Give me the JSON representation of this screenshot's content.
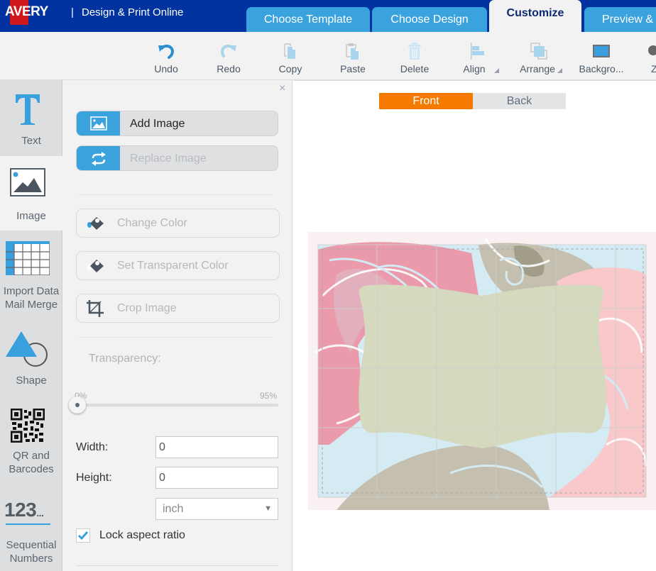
{
  "header": {
    "logo": "AVERY",
    "separator": "|",
    "title": "Design & Print Online",
    "tabs": [
      {
        "label": "Choose Template",
        "active": false
      },
      {
        "label": "Choose Design",
        "active": false
      },
      {
        "label": "Customize",
        "active": true
      },
      {
        "label": "Preview &",
        "active": false
      }
    ]
  },
  "toolbar": {
    "items": [
      {
        "label": "Undo",
        "icon": "undo-icon",
        "enabled": true
      },
      {
        "label": "Redo",
        "icon": "redo-icon",
        "enabled": false
      },
      {
        "label": "Copy",
        "icon": "copy-icon",
        "enabled": false
      },
      {
        "label": "Paste",
        "icon": "paste-icon",
        "enabled": false
      },
      {
        "label": "Delete",
        "icon": "delete-icon",
        "enabled": false
      },
      {
        "label": "Align",
        "icon": "align-icon",
        "enabled": false
      },
      {
        "label": "Arrange",
        "icon": "arrange-icon",
        "enabled": false
      },
      {
        "label": "Backgro...",
        "icon": "background-icon",
        "enabled": true
      },
      {
        "label": "Z",
        "icon": "zoom-icon",
        "enabled": true
      }
    ]
  },
  "sidebar": {
    "items": [
      {
        "label": "Text",
        "icon": "text-icon",
        "active": false
      },
      {
        "label": "Image",
        "icon": "image-icon",
        "active": true
      },
      {
        "label": "Import Data Mail Merge",
        "line1": "Import Data",
        "line2": "Mail Merge",
        "icon": "table-icon",
        "active": false
      },
      {
        "label": "Shape",
        "icon": "shape-icon",
        "active": false
      },
      {
        "label": "QR and Barcodes",
        "line1": "QR and",
        "line2": "Barcodes",
        "icon": "qr-code-icon",
        "active": false
      },
      {
        "label": "Sequential Numbers",
        "line1": "Sequential",
        "line2": "Numbers",
        "glyph": "123",
        "icon": "sequential-numbers-icon",
        "active": false
      }
    ]
  },
  "panel": {
    "close": "×",
    "add_image": "Add Image",
    "replace_image": "Replace Image",
    "change_color": "Change Color",
    "set_transparent_color": "Set Transparent Color",
    "crop_image": "Crop Image",
    "transparency": {
      "label": "Transparency:",
      "min_label": "0%",
      "max_label": "95%",
      "value_percent": 0
    },
    "width": {
      "label": "Width:",
      "value": "0"
    },
    "height": {
      "label": "Height:",
      "value": "0"
    },
    "unit": {
      "selected": "inch"
    },
    "lock_aspect": {
      "label": "Lock aspect ratio",
      "checked": true
    }
  },
  "canvas": {
    "sides": [
      {
        "label": "Front",
        "active": true
      },
      {
        "label": "Back",
        "active": false
      }
    ],
    "colors": {
      "accent_orange": "#f47a00",
      "brand_blue": "#0033a0",
      "tab_blue": "#3aa2dc",
      "rose_pink": "#ea9aab",
      "rose_light": "#f8c8cb",
      "rose_taupe": "#c4bfae",
      "frame_sage": "#d5d9bd",
      "outline_blue": "#d4ebf4"
    }
  }
}
